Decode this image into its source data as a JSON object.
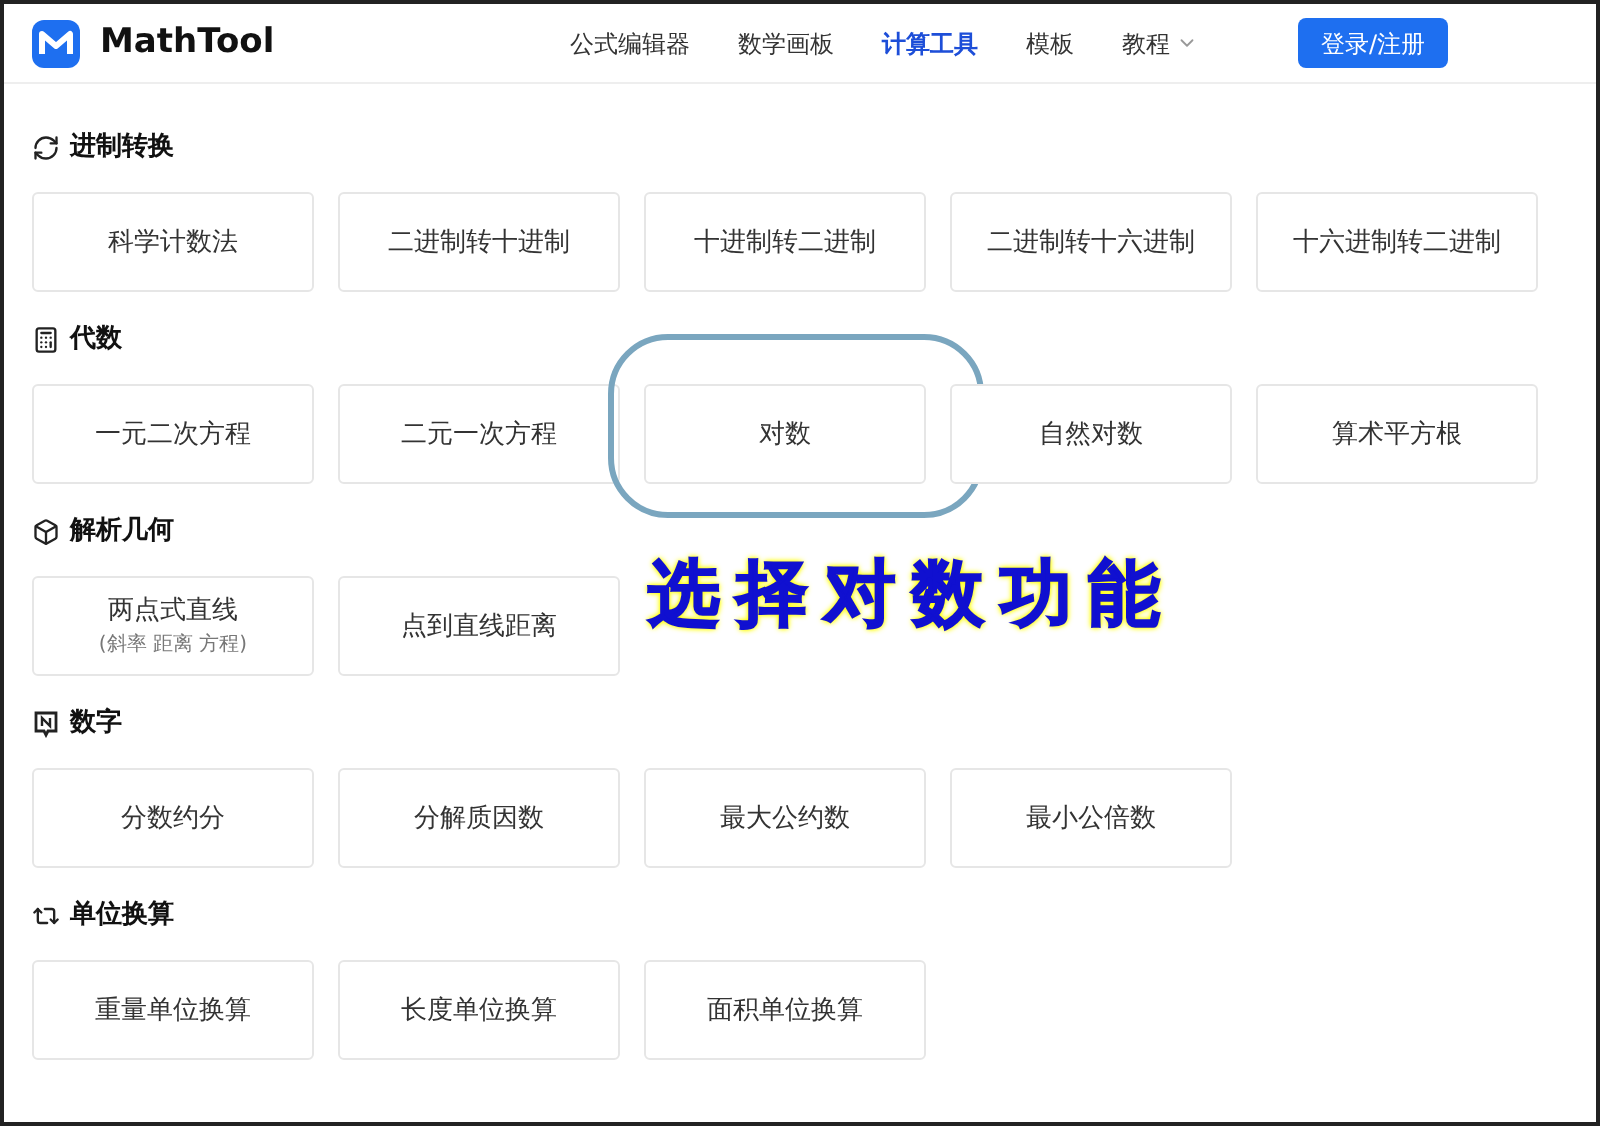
{
  "header": {
    "logo_text": "MathTool",
    "nav": [
      {
        "label": "公式编辑器",
        "selected": false,
        "has_menu": false
      },
      {
        "label": "数学画板",
        "selected": false,
        "has_menu": false
      },
      {
        "label": "计算工具",
        "selected": true,
        "has_menu": false
      },
      {
        "label": "模板",
        "selected": false,
        "has_menu": false
      },
      {
        "label": "教程",
        "selected": false,
        "has_menu": true
      }
    ],
    "login_button": "登录/注册"
  },
  "sections": [
    {
      "title": "进制转换",
      "items": [
        {
          "label": "科学计数法",
          "highlighted": false
        },
        {
          "label": "二进制转十进制",
          "highlighted": false
        },
        {
          "label": "十进制转二进制",
          "highlighted": false
        },
        {
          "label": "二进制转十六进制",
          "highlighted": false
        },
        {
          "label": "十六进制转二进制",
          "highlighted": false
        }
      ]
    },
    {
      "title": "代数",
      "items": [
        {
          "label": "一元二次方程",
          "highlighted": false
        },
        {
          "label": "二元一次方程",
          "highlighted": false
        },
        {
          "label": "对数",
          "highlighted": true
        },
        {
          "label": "自然对数",
          "highlighted": false
        },
        {
          "label": "算术平方根",
          "highlighted": false
        }
      ]
    },
    {
      "title": "解析几何",
      "items": [
        {
          "label": "两点式直线",
          "subtitle": "(斜率 距离 方程)",
          "highlighted": false
        },
        {
          "label": "点到直线距离",
          "highlighted": false
        }
      ]
    },
    {
      "title": "数字",
      "items": [
        {
          "label": "分数约分",
          "highlighted": false
        },
        {
          "label": "分解质因数",
          "highlighted": false
        },
        {
          "label": "最大公约数",
          "highlighted": false
        },
        {
          "label": "最小公倍数",
          "highlighted": false
        }
      ]
    },
    {
      "title": "单位换算",
      "items": [
        {
          "label": "重量单位换算",
          "highlighted": false
        },
        {
          "label": "长度单位换算",
          "highlighted": false
        },
        {
          "label": "面积单位换算",
          "highlighted": false
        }
      ]
    }
  ],
  "annotation": {
    "text": "选择对数功能"
  }
}
